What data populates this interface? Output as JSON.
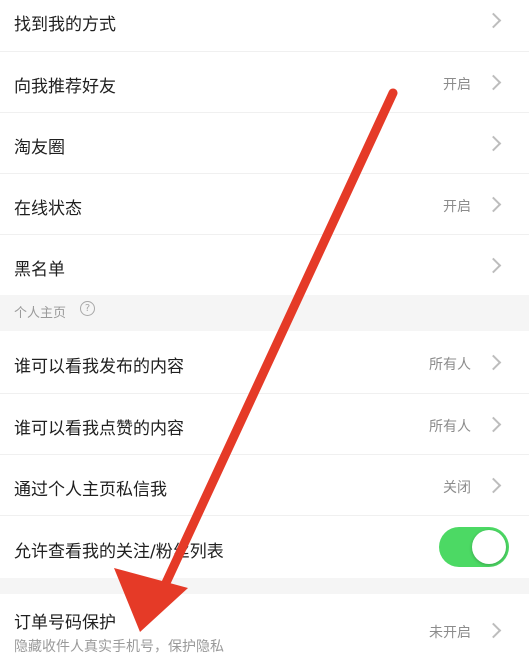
{
  "settings": {
    "rows_top": [
      {
        "label": "找到我的方式",
        "value": ""
      },
      {
        "label": "向我推荐好友",
        "value": "开启"
      },
      {
        "label": "淘友圈",
        "value": ""
      },
      {
        "label": "在线状态",
        "value": "开启"
      },
      {
        "label": "黑名单",
        "value": ""
      }
    ],
    "section_personal": {
      "title": "个人主页",
      "help_icon": "?"
    },
    "rows_personal": [
      {
        "label": "谁可以看我发布的内容",
        "value": "所有人"
      },
      {
        "label": "谁可以看我点赞的内容",
        "value": "所有人"
      },
      {
        "label": "通过个人主页私信我",
        "value": "关闭"
      }
    ],
    "toggle_row": {
      "label": "允许查看我的关注/粉丝列表",
      "state": "on",
      "color": "#4cd964"
    },
    "order_row": {
      "label": "订单号码保护",
      "sublabel": "隐藏收件人真实手机号，保护隐私",
      "value": "未开启"
    }
  },
  "annotation": {
    "type": "red-arrow",
    "color": "#e53a27",
    "icon": "arrow-down-left"
  }
}
